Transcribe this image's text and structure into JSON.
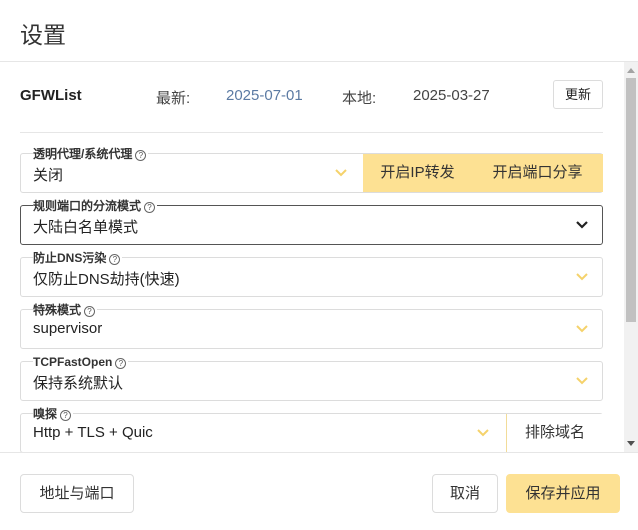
{
  "dialog": {
    "title": "设置"
  },
  "gfwlist": {
    "name": "GFWList",
    "latest_label": "最新:",
    "latest_value": "2025-07-01",
    "local_label": "本地:",
    "local_value": "2025-03-27",
    "update_label": "更新"
  },
  "fields": {
    "proxy": {
      "label": "透明代理/系统代理",
      "value": "关闭",
      "btn1": "开启IP转发",
      "btn2": "开启端口分享"
    },
    "rule": {
      "label": "规则端口的分流模式",
      "value": "大陆白名单模式"
    },
    "dns": {
      "label": "防止DNS污染",
      "value": "仅防止DNS劫持(快速)"
    },
    "special": {
      "label": "特殊模式",
      "value": "supervisor"
    },
    "tfo": {
      "label": "TCPFastOpen",
      "value": "保持系统默认"
    },
    "sniff": {
      "label": "嗅探",
      "value": "Http + TLS + Quic",
      "btn": "排除域名"
    }
  },
  "help_glyph": "?",
  "footer": {
    "address_port": "地址与端口",
    "cancel": "取消",
    "save_apply": "保存并应用"
  },
  "colors": {
    "accent": "#fde193",
    "link": "#5b7aa3",
    "chevron": "#f5d26b"
  },
  "icons": {
    "help": "help-circle-icon",
    "chevron": "chevron-down-icon"
  }
}
